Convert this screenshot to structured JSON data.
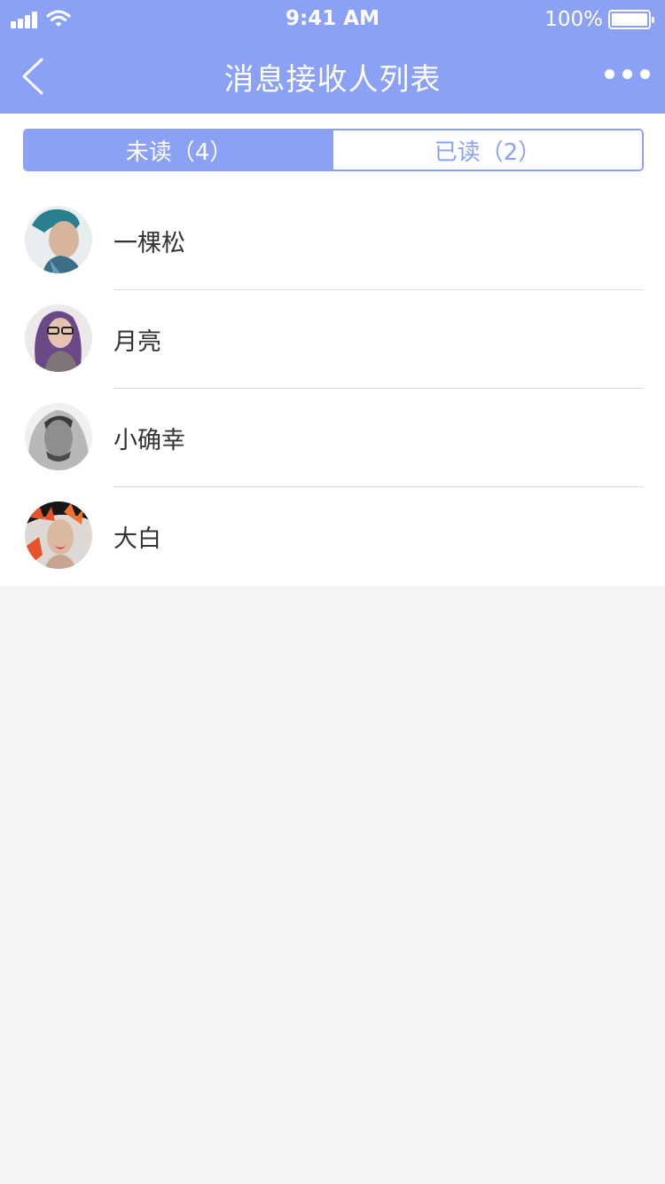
{
  "status_bar": {
    "time": "9:41 AM",
    "battery": "100%"
  },
  "nav": {
    "title": "消息接收人列表"
  },
  "tabs": [
    {
      "label": "未读（4）",
      "active": true
    },
    {
      "label": "已读（2）",
      "active": false
    }
  ],
  "recipients": [
    {
      "name": "一棵松",
      "avatar": "avatar-man-teal-hair"
    },
    {
      "name": "月亮",
      "avatar": "avatar-woman-glasses-purple-hair"
    },
    {
      "name": "小确幸",
      "avatar": "avatar-man-hoodie-grayscale"
    },
    {
      "name": "大白",
      "avatar": "avatar-woman-orange-flowers"
    }
  ],
  "colors": {
    "accent": "#8aa1f5",
    "background": "#f4f4f4",
    "divider": "#dcdcdc"
  }
}
